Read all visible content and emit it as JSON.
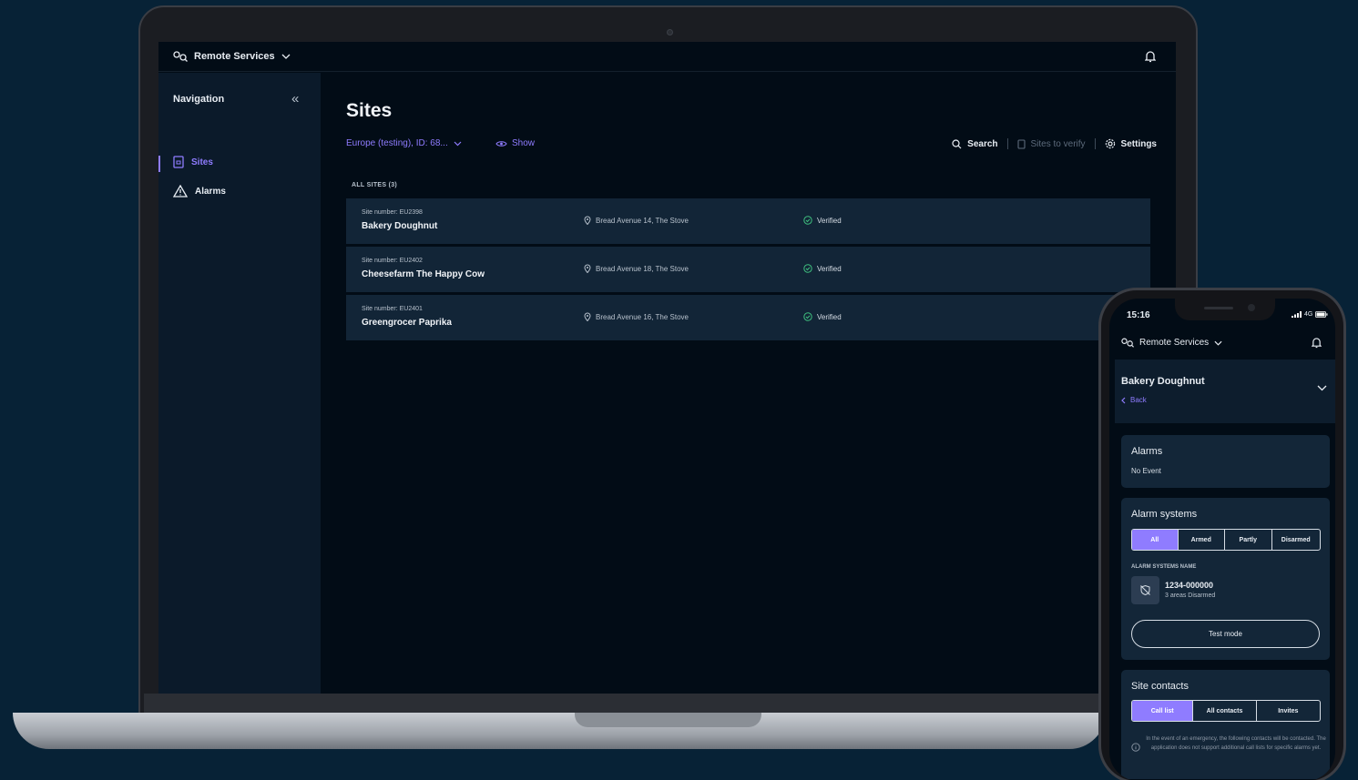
{
  "app": {
    "brand": "Remote Services",
    "nav_title": "Navigation",
    "nav_items": [
      {
        "label": "Sites",
        "icon": "sites-icon",
        "active": true
      },
      {
        "label": "Alarms",
        "icon": "alarm-triangle-icon",
        "active": false
      }
    ]
  },
  "main": {
    "title": "Sites",
    "filter": "Europe (testing), ID: 68...",
    "show": "Show",
    "toolbar": {
      "search": "Search",
      "sites_to_verify": "Sites to verify",
      "settings": "Settings"
    },
    "all_sites_label": "ALL SITES (3)",
    "sites": [
      {
        "number": "Site number: EU2398",
        "name": "Bakery Doughnut",
        "address": "Bread Avenue 14, The Stove",
        "status": "Verified"
      },
      {
        "number": "Site number: EU2402",
        "name": "Cheesefarm The Happy Cow",
        "address": "Bread Avenue 18, The Stove",
        "status": "Verified"
      },
      {
        "number": "Site number: EU2401",
        "name": "Greengrocer Paprika",
        "address": "Bread Avenue 16, The Stove",
        "status": "Verified"
      }
    ]
  },
  "phone": {
    "time": "15:16",
    "network": "4G",
    "brand": "Remote Services",
    "site_name": "Bakery Doughnut",
    "back": "Back",
    "alarms": {
      "title": "Alarms",
      "subtitle": "No Event"
    },
    "alarm_systems": {
      "title": "Alarm systems",
      "filters": [
        "All",
        "Armed",
        "Partly",
        "Disarmed"
      ],
      "list_label": "ALARM SYSTEMS NAME",
      "system_name": "1234-000000",
      "system_status": "3 areas Disarmed",
      "test_mode": "Test mode"
    },
    "site_contacts": {
      "title": "Site contacts",
      "tabs": [
        "Call list",
        "All contacts",
        "Invites"
      ],
      "note": "In the event of an emergency, the following contacts will be contacted. The application does not support additional call lists for specific alarms yet."
    }
  },
  "colors": {
    "accent": "#8f7cff",
    "background": "#072236",
    "card": "#122537",
    "verified": "#3fbf7f"
  }
}
